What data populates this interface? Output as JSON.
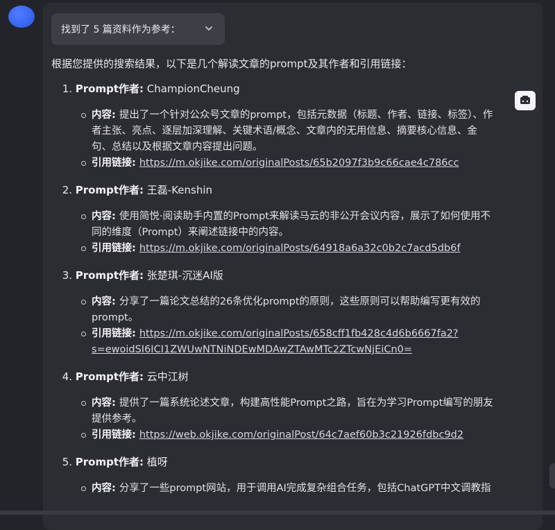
{
  "sources_toggle": {
    "label": "找到了 5 篇资料作为参考："
  },
  "intro": "根据您提供的搜索结果，以下是几个解读文章的prompt及其作者和引用链接：",
  "labels": {
    "author": "Prompt作者",
    "content": "内容",
    "link": "引用链接"
  },
  "items": [
    {
      "num": "1.",
      "author": "ChampionCheung",
      "content_lines": [
        "提出了一个针对公众号文章的prompt，包括元数据（标题、作者、链接、标签）、作",
        "者主张、亮点、逐层加深理解、关键术语/概念、文章内的无用信息、摘要核心信息、金",
        "句、总结以及根据文章内容提出问题。"
      ],
      "link_lines": [
        "https://m.okjike.com/originalPosts/65b2097f3b9c66cae4c786cc"
      ]
    },
    {
      "num": "2.",
      "author": "王磊-Kenshin",
      "content_lines": [
        "使用简悦·阅读助手内置的Prompt来解读马云的非公开会议内容，展示了如何使用不",
        "同的维度（Prompt）来阐述链接中的内容。"
      ],
      "link_lines": [
        "https://m.okjike.com/originalPosts/64918a6a32c0b2c7acd5db6f"
      ]
    },
    {
      "num": "3.",
      "author": "张楚琪-沉迷AI版",
      "content_lines": [
        "分享了一篇论文总结的26条优化prompt的原则，这些原则可以帮助编写更有效的",
        "prompt。"
      ],
      "link_lines": [
        "https://m.okjike.com/originalPosts/658cff1fb428c4d6b6667fa2?",
        "s=ewoidSI6ICI1ZWUwNTNiNDEwMDAwZTAwMTc2ZTcwNjEiCn0="
      ]
    },
    {
      "num": "4.",
      "author": "云中江树",
      "content_lines": [
        "提供了一篇系统论述文章，构建高性能Prompt之路，旨在为学习Prompt编写的朋友",
        "提供参考。"
      ],
      "link_lines": [
        "https://web.okjike.com/originalPost/64c7aef60b3c21926fdbc9d2"
      ]
    },
    {
      "num": "5.",
      "author": "植呀",
      "content_lines": [
        "分享了一些prompt网站，用于调用AI完成复杂组合任务，包括ChatGPT中文调教指"
      ],
      "link_lines": []
    }
  ]
}
